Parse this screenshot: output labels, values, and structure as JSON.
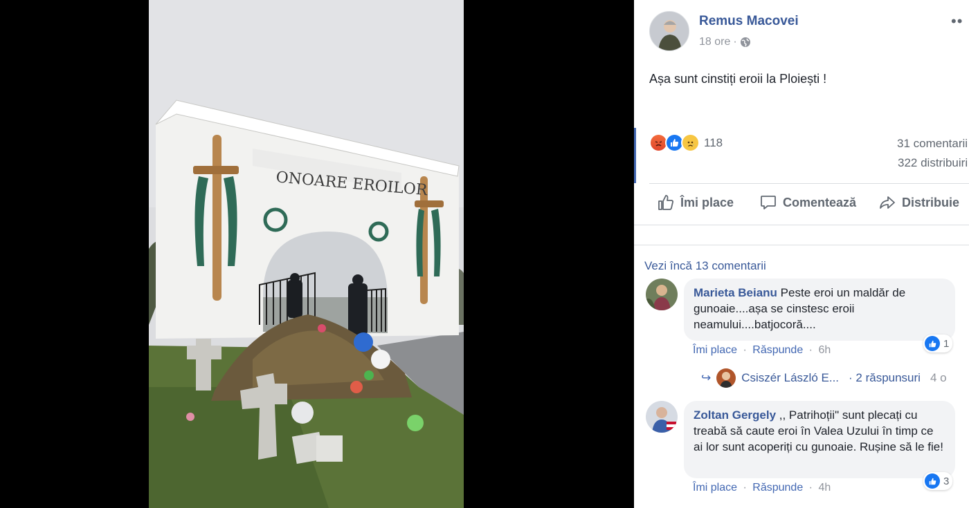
{
  "post": {
    "author": "Remus Macovei",
    "time": "18 ore",
    "time_separator": "·",
    "text": "Așa sunt cinstiți eroii la Ploiești !",
    "more_icon": "more-icon",
    "privacy_icon": "globe-icon"
  },
  "photo": {
    "gate_inscription": "ONOARE EROILOR"
  },
  "stats": {
    "reactions": [
      "angry",
      "like",
      "sad"
    ],
    "reaction_count": "118",
    "comments": "31 comentarii",
    "shares": "322 distribuiri"
  },
  "actions": {
    "like": "Îmi place",
    "comment": "Comentează",
    "share": "Distribuie"
  },
  "comments": {
    "view_more": "Vezi încă 13 comentarii",
    "items": [
      {
        "author": "Marieta Beianu",
        "text": "Peste eroi un maldăr de gunoaie....așa se cinstesc eroii neamului....batjocoră....",
        "like": "Îmi place",
        "reply": "Răspunde",
        "time": "6h",
        "reactions": "1"
      },
      {
        "author": "Zoltan Gergely",
        "text": ",, Patrihoții\" sunt plecați cu treabă să caute eroi în Valea Uzului în timp ce ai lor sunt acoperiți cu gunoaie. Rușine să le fie!",
        "like": "Îmi place",
        "reply": "Răspunde",
        "time": "4h",
        "reactions": "3"
      }
    ],
    "reply_preview": {
      "author": "Csiszér László E...",
      "count": "· 2 răspunsuri",
      "time": "4 o"
    },
    "separator": "·"
  },
  "colors": {
    "link": "#385898",
    "like_blue": "#1877f2",
    "secondary_text": "#606770",
    "divider": "#dadde1"
  }
}
